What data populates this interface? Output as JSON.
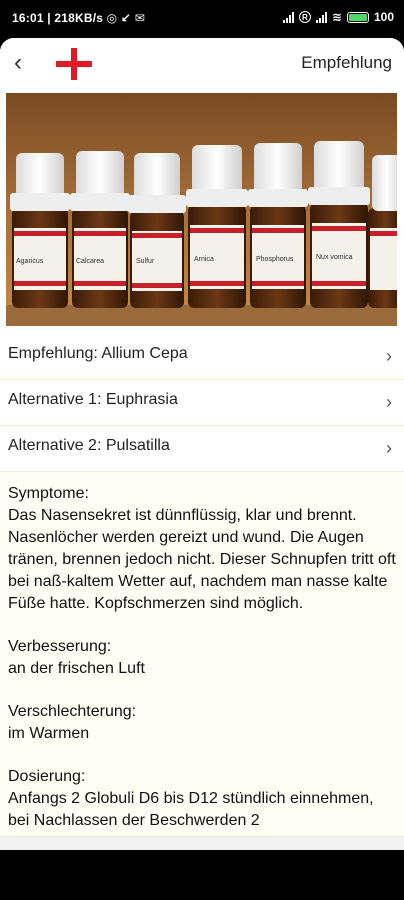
{
  "status_bar": {
    "time": "16:01",
    "network_speed": "218KB/s",
    "battery": "100"
  },
  "app_bar": {
    "back_icon": "chevron-left-icon",
    "logo_icon": "red-cross-icon",
    "title": "Empfehlung",
    "accent_color": "#e01b24"
  },
  "hero": {
    "vial_labels": [
      "Agaricus",
      "Calcarea",
      "Sulfur",
      "Arnica",
      "Phosphorus",
      "Nux vomica",
      ""
    ]
  },
  "remedies": [
    {
      "label": "Empfehlung: Allium Cepa"
    },
    {
      "label": "Alternative 1: Euphrasia"
    },
    {
      "label": "Alternative 2: Pulsatilla"
    }
  ],
  "description": {
    "symptoms_heading": "Symptome:",
    "symptoms_text": "Das Nasensekret ist dünnflüssig, klar und brennt. Nasenlöcher werden gereizt und wund. Die Augen tränen, brennen jedoch nicht. Dieser Schnupfen tritt oft bei naß-kaltem Wetter auf, nachdem man nasse kalte Füße hatte. Kopfschmerzen sind möglich.",
    "improvement_heading": "Verbesserung:",
    "improvement_text": "an der frischen Luft",
    "worsening_heading": "Verschlechterung:",
    "worsening_text": "im Warmen",
    "dosage_heading": "Dosierung:",
    "dosage_text": "Anfangs 2 Globuli D6 bis D12 stündlich einnehmen, bei Nachlassen der Beschwerden 2"
  },
  "nav_bar": {
    "items": [
      "recent-apps-icon",
      "home-icon",
      "back-triangle-icon"
    ]
  }
}
